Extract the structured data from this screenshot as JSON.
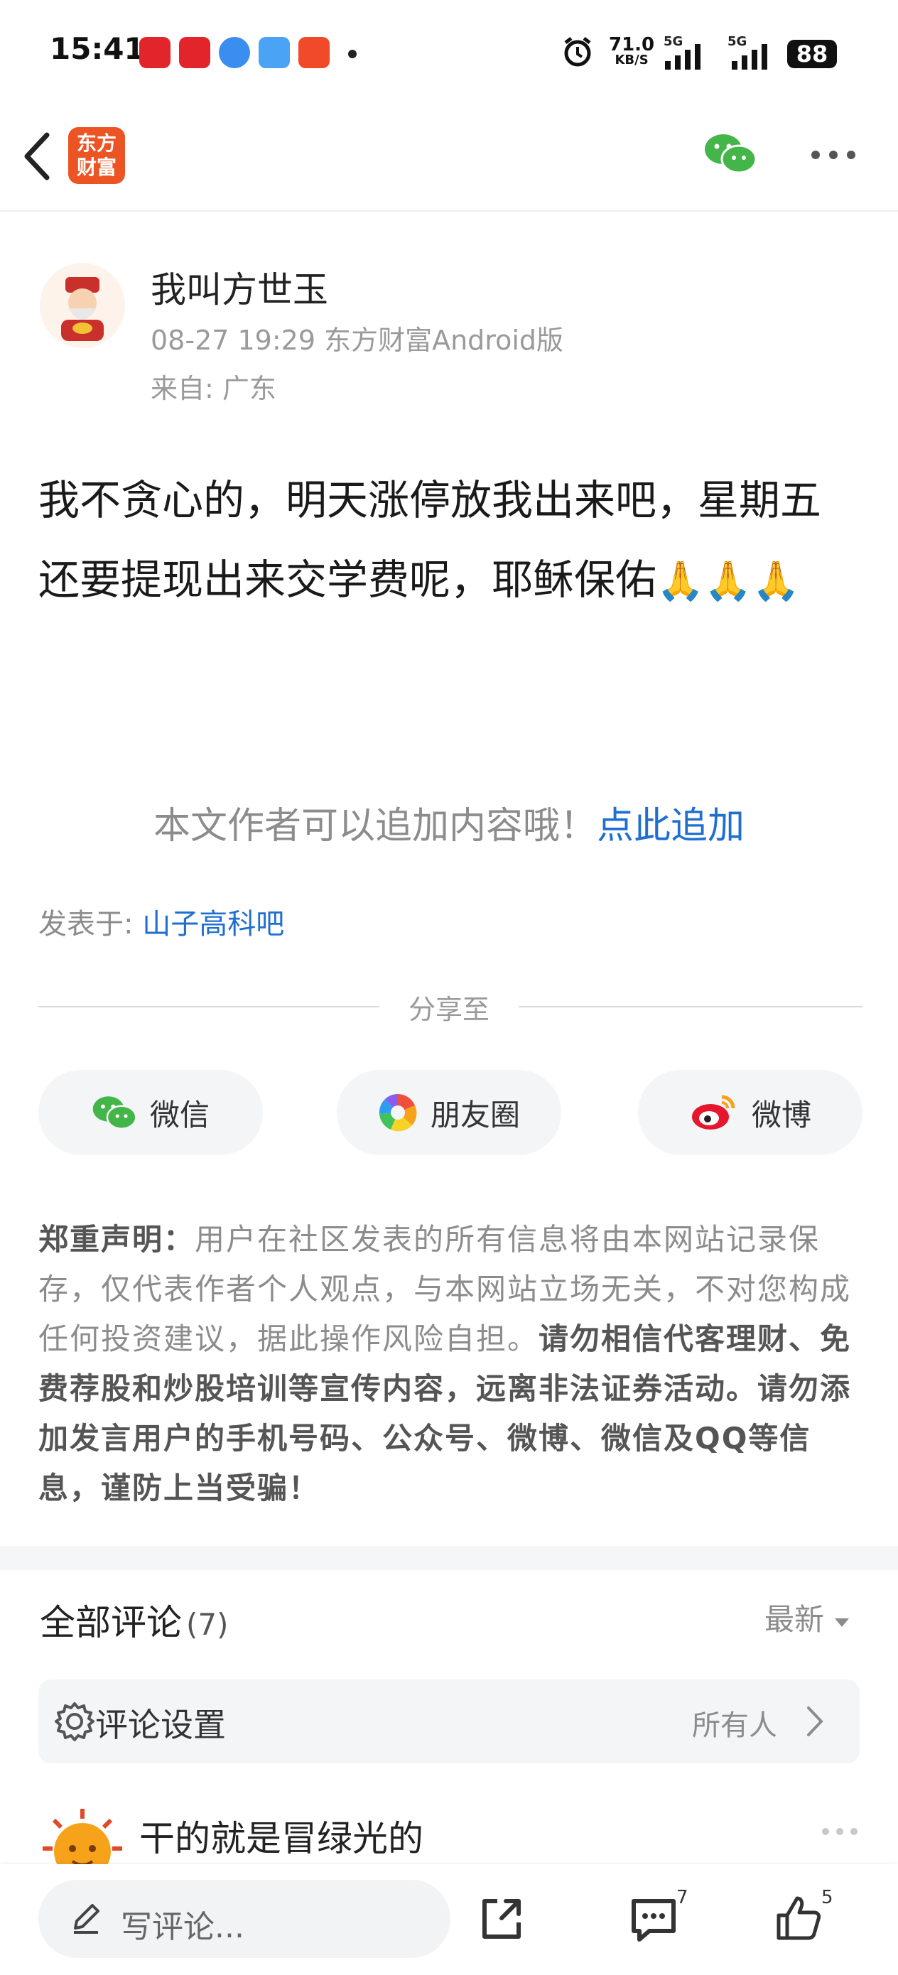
{
  "status_bar": {
    "time": "15:41",
    "net_speed": "71.0",
    "net_unit": "KB/S",
    "signal1": "5G",
    "signal2": "5G",
    "battery": "88"
  },
  "header": {
    "logo_text_line1": "东方",
    "logo_text_line2": "财富",
    "brand_color": "#ec5424"
  },
  "author": {
    "name": "我叫方世玉",
    "meta": "08-27 19:29 东方财富Android版",
    "location": "来自: 广东"
  },
  "post": {
    "text": "我不贪心的，明天涨停放我出来吧，星期五还要提现出来交学费呢，耶稣保佑",
    "emoji": "🙏🙏🙏"
  },
  "append": {
    "prompt": "本文作者可以追加内容哦！",
    "link": "点此追加"
  },
  "forum": {
    "label": "发表于:",
    "name": "山子高科吧"
  },
  "share": {
    "title": "分享至",
    "wechat": "微信",
    "moments": "朋友圈",
    "weibo": "微博"
  },
  "disclaimer": {
    "title": "郑重声明：",
    "body": "用户在社区发表的所有信息将由本网站记录保存，仅代表作者个人观点，与本网站立场无关，不对您构成任何投资建议，据此操作风险自担。",
    "bold": "请勿相信代客理财、免费荐股和炒股培训等宣传内容，远离非法证券活动。请勿添加发言用户的手机号码、公众号、微博、微信及QQ等信息，谨防上当受骗！"
  },
  "comments": {
    "title": "全部评论",
    "count": "(7)",
    "sort": "最新",
    "settings_label": "评论设置",
    "settings_value": "所有人",
    "first_author": "干的就是冒绿光的"
  },
  "bottom_bar": {
    "placeholder": "写评论...",
    "comment_count": "7",
    "like_count": "5"
  }
}
